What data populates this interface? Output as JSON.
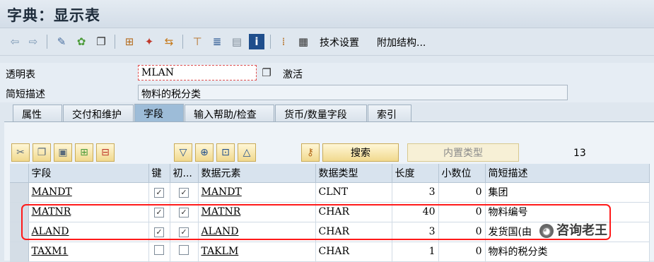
{
  "window": {
    "title": "字典：显示表"
  },
  "toolbar": {
    "tech_settings": "技术设置",
    "append_structure": "附加结构...",
    "icons": [
      "back-icon",
      "forward-icon",
      "tools-icon",
      "object-list-icon",
      "copy-icon",
      "hierarchy-icon",
      "magic-wand-icon",
      "transport-icon",
      "tree-icon",
      "stack-icon",
      "list-icon",
      "info-icon",
      "grid-icon",
      "table-icon"
    ]
  },
  "header": {
    "transparent_table_label": "透明表",
    "transparent_table_value": "MLAN",
    "status": "激活",
    "short_desc_label": "简短描述",
    "short_desc_value": "物料的税分类"
  },
  "tabs": [
    {
      "label": "属性",
      "active": false
    },
    {
      "label": "交付和维护",
      "active": false
    },
    {
      "label": "字段",
      "active": true
    },
    {
      "label": "输入帮助/检查",
      "active": false
    },
    {
      "label": "货币/数量字段",
      "active": false
    },
    {
      "label": "索引",
      "active": false
    }
  ],
  "fields_toolbar": {
    "search_label": "搜索",
    "builtin_type_label": "内置类型",
    "count": "13"
  },
  "table": {
    "columns": [
      "字段",
      "键",
      "初...",
      "数据元素",
      "数据类型",
      "长度",
      "小数位",
      "简短描述"
    ],
    "rows": [
      {
        "field": "MANDT",
        "key": true,
        "init": true,
        "data_element": "MANDT",
        "data_type": "CLNT",
        "length": "3",
        "decimals": "0",
        "desc": "集团"
      },
      {
        "field": "MATNR",
        "key": true,
        "init": true,
        "data_element": "MATNR",
        "data_type": "CHAR",
        "length": "40",
        "decimals": "0",
        "desc": "物料编号"
      },
      {
        "field": "ALAND",
        "key": true,
        "init": true,
        "data_element": "ALAND",
        "data_type": "CHAR",
        "length": "3",
        "decimals": "0",
        "desc": "发货国(由"
      },
      {
        "field": "TAXM1",
        "key": false,
        "init": false,
        "data_element": "TAKLM",
        "data_type": "CHAR",
        "length": "1",
        "decimals": "0",
        "desc": "物料的税分类"
      }
    ]
  },
  "watermark": {
    "text": "咨询老王"
  },
  "colors": {
    "highlight": "#ff1a1a",
    "active_tab": "#9dbcd8",
    "button": "#f1d98e"
  }
}
